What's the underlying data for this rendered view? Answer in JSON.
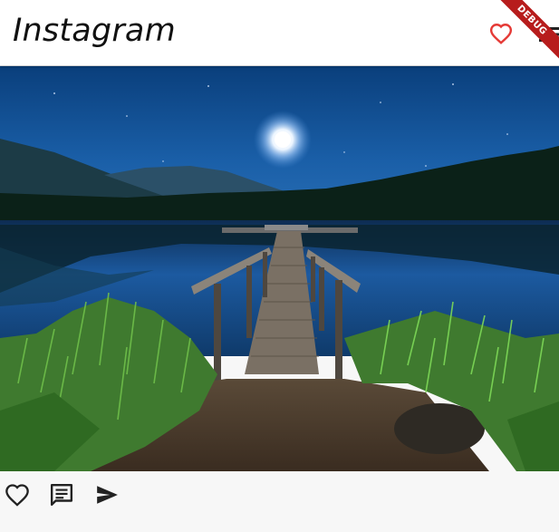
{
  "app": {
    "title": "Instagram"
  },
  "debug_banner": {
    "label": "DEBUG",
    "color": "#b71c1c"
  },
  "appbar_icons": [
    "heart-outline-icon",
    "menu-icon"
  ],
  "post": {
    "image": "night-lake-pier-photo",
    "actions": [
      "like-icon",
      "comment-icon",
      "send-icon"
    ]
  },
  "colors": {
    "heart": "#e53935",
    "icon": "#222222",
    "appbar": "#ffffff"
  }
}
